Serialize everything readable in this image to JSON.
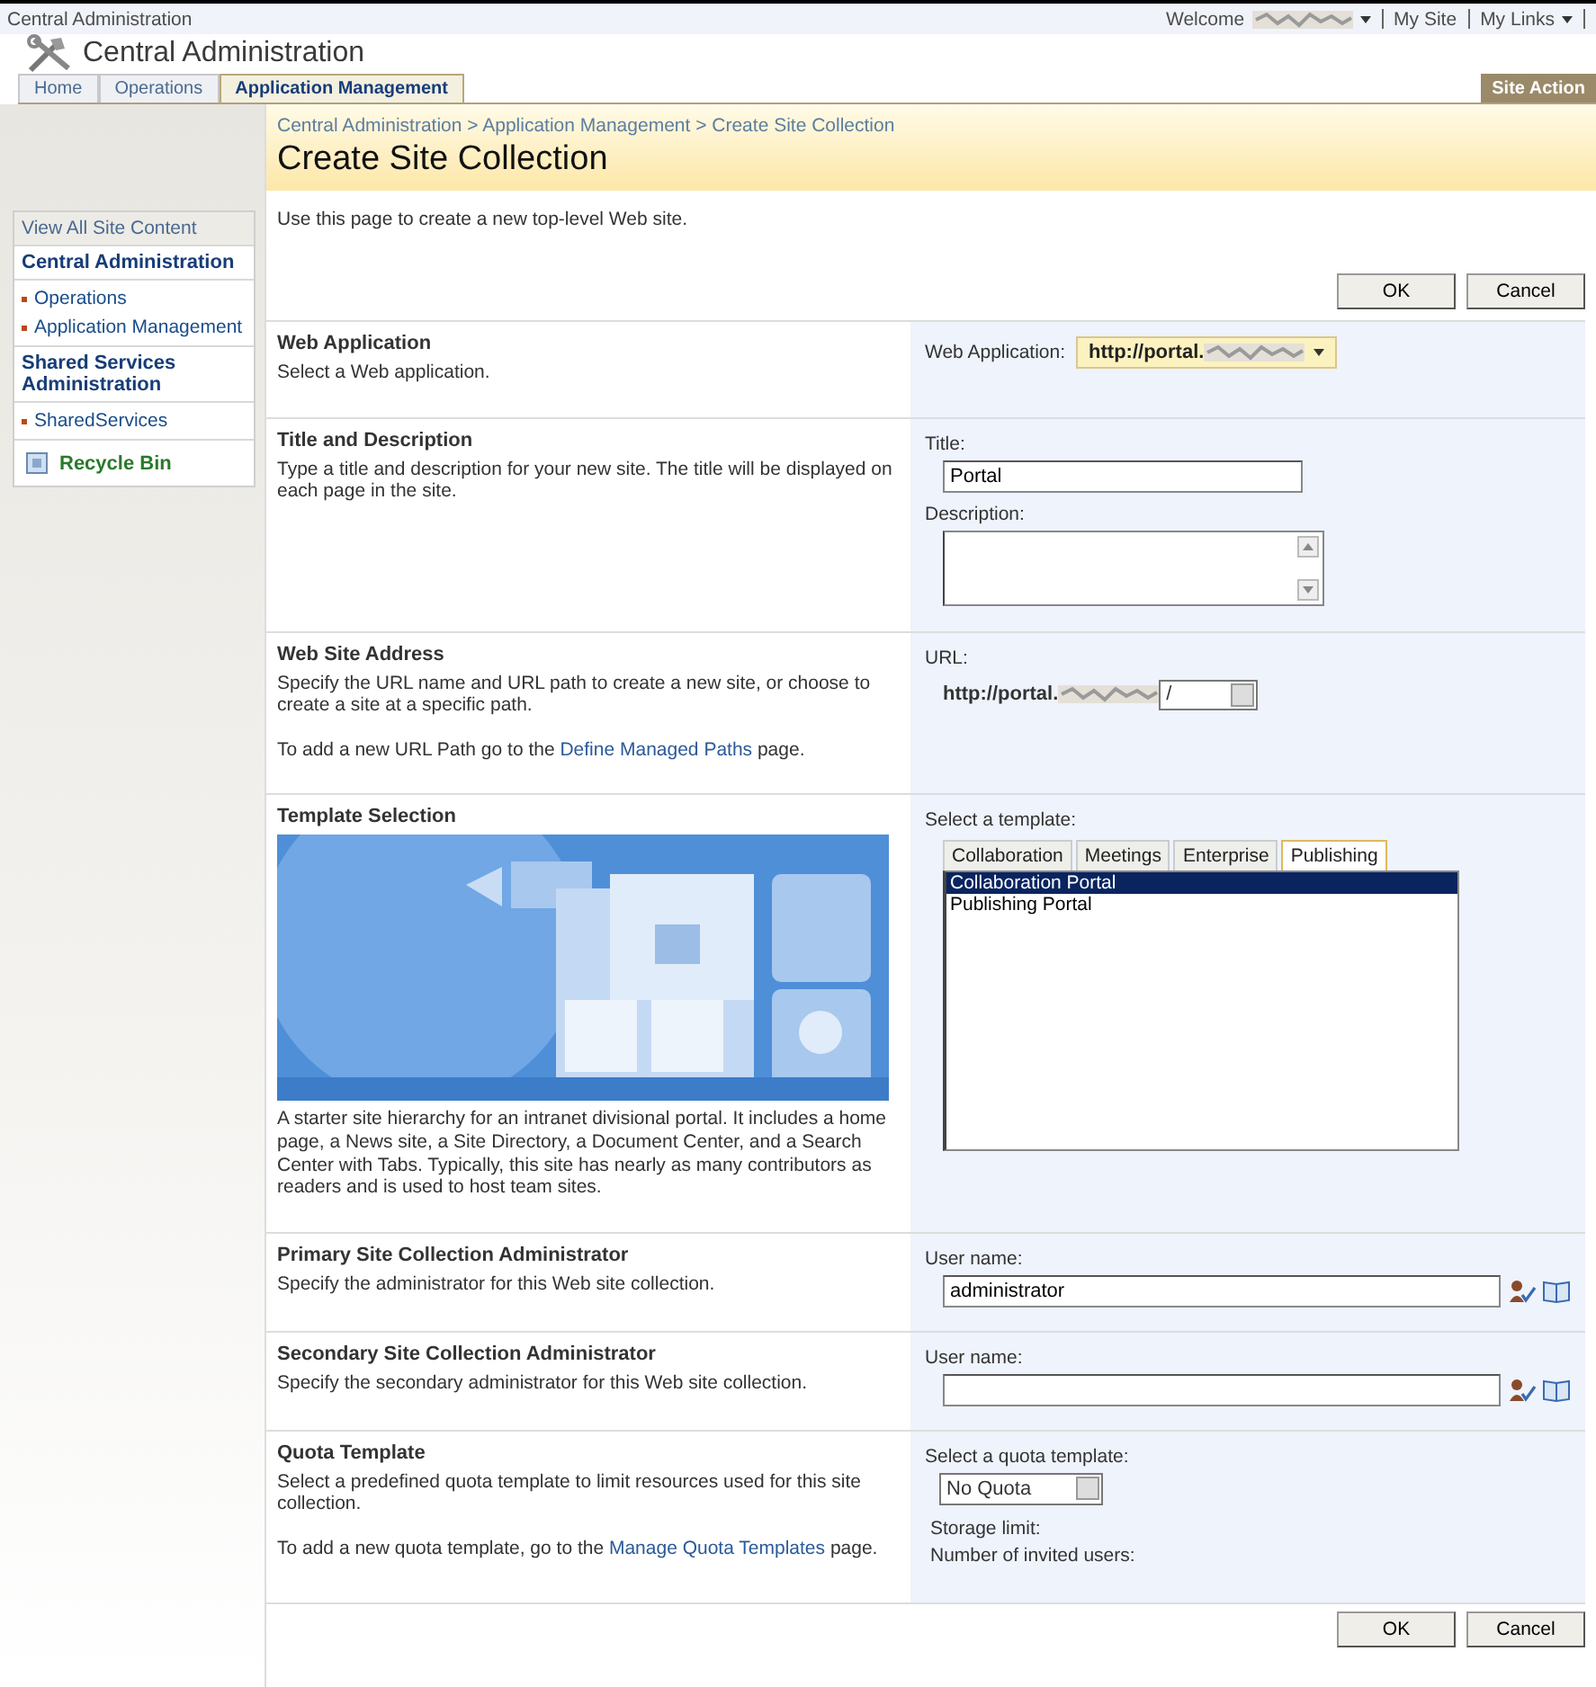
{
  "top_bar": {
    "site": "Central Administration",
    "welcome": "Welcome",
    "links": [
      "My Site",
      "My Links"
    ]
  },
  "header": {
    "title": "Central Administration"
  },
  "tabs": [
    {
      "label": "Home",
      "selected": false
    },
    {
      "label": "Operations",
      "selected": false
    },
    {
      "label": "Application Management",
      "selected": true
    }
  ],
  "site_actions": "Site Action",
  "breadcrumb": "Central Administration > Application Management > Create Site Collection",
  "page_title": "Create Site Collection",
  "sidebar": {
    "view_all": "View All Site Content",
    "groups": [
      {
        "heading": "Central Administration",
        "items": [
          "Operations",
          "Application Management"
        ]
      },
      {
        "heading": "Shared Services Administration",
        "items": [
          "SharedServices"
        ]
      }
    ],
    "recycle_bin": "Recycle Bin"
  },
  "intro": "Use this page to create a new top-level Web site.",
  "top_buttons": [
    "OK",
    "Cancel"
  ],
  "sections": [
    {
      "kind": "web_app",
      "heading": "Web Application",
      "paragraphs": [
        {
          "before": "Select a Web application."
        }
      ],
      "label": "Web Application:",
      "value": "http://portal."
    },
    {
      "kind": "title_desc",
      "heading": "Title and Description",
      "paragraphs": [
        {
          "before": "Type a title and description for your new site. The title will be displayed on each page in the site."
        }
      ],
      "label": "Title:",
      "value": "Portal",
      "label2": "Description:"
    },
    {
      "kind": "url",
      "heading": "Web Site Address",
      "paragraphs": [
        {
          "before": "Specify the URL name and URL path to create a new site, or choose to create a site at a specific path."
        },
        {
          "before": "To add a new URL Path go to the ",
          "link": "Define Managed Paths",
          "after": " page."
        }
      ],
      "label": "URL:",
      "value": "http://portal.",
      "path": "/"
    },
    {
      "kind": "template",
      "heading": "Template Selection",
      "paragraphs": [
        {
          "before": "A starter site hierarchy for an intranet divisional portal. It includes a home page, a News site, a Site Directory, a Document Center, and a Search Center with Tabs. Typically, this site has nearly as many contributors as readers and is used to host team sites."
        }
      ],
      "label": "Select a template:",
      "tabs": [
        {
          "label": "Collaboration",
          "selected": false
        },
        {
          "label": "Meetings",
          "selected": false
        },
        {
          "label": "Enterprise",
          "selected": false
        },
        {
          "label": "Publishing",
          "selected": true
        }
      ],
      "items": [
        {
          "label": "Collaboration Portal",
          "selected": true
        },
        {
          "label": "Publishing Portal",
          "selected": false
        }
      ]
    },
    {
      "kind": "user",
      "heading": "Primary Site Collection Administrator",
      "paragraphs": [
        {
          "before": "Specify the administrator for this Web site collection."
        }
      ],
      "label": "User name:",
      "value": "administrator"
    },
    {
      "kind": "user",
      "heading": "Secondary Site Collection Administrator",
      "paragraphs": [
        {
          "before": "Specify the secondary administrator for this Web site collection."
        }
      ],
      "label": "User name:"
    },
    {
      "kind": "quota",
      "heading": "Quota Template",
      "paragraphs": [
        {
          "before": "Select a predefined quota template to limit resources used for this site collection."
        },
        {
          "before": "To add a new quota template, go to the ",
          "link": "Manage Quota Templates",
          "after": " page."
        }
      ],
      "label": "Select a quota template:",
      "value": "No Quota",
      "lines": [
        "Storage limit:",
        "Number of invited users:"
      ]
    }
  ],
  "bottom_buttons": [
    "OK",
    "Cancel"
  ]
}
